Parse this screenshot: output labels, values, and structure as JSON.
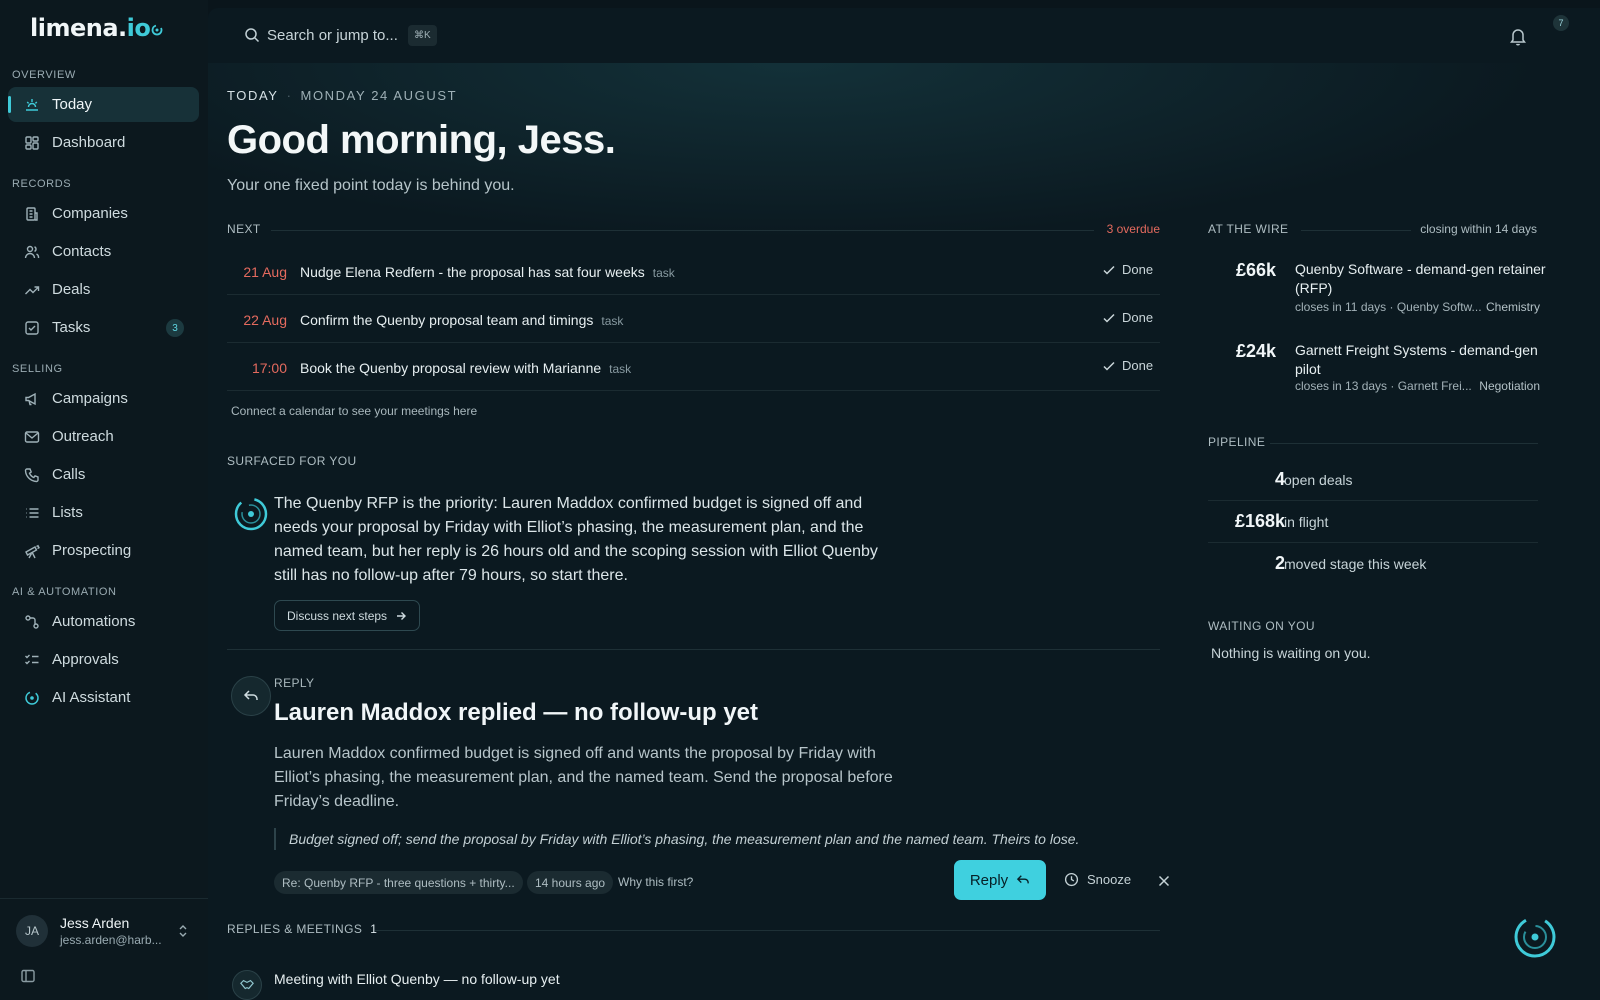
{
  "brand": {
    "logo_main": "limena.",
    "logo_accent": "io",
    "accent_color": "#3fcad8"
  },
  "sidebar": {
    "sections": {
      "overview": "OVERVIEW",
      "records": "RECORDS",
      "selling": "SELLING",
      "ai": "AI & AUTOMATION"
    },
    "items": {
      "today": "Today",
      "dashboard": "Dashboard",
      "companies": "Companies",
      "contacts": "Contacts",
      "deals": "Deals",
      "tasks": "Tasks",
      "tasks_badge": "3",
      "campaigns": "Campaigns",
      "outreach": "Outreach",
      "calls": "Calls",
      "lists": "Lists",
      "prospecting": "Prospecting",
      "automations": "Automations",
      "approvals": "Approvals",
      "assistant": "AI Assistant"
    },
    "user": {
      "initials": "JA",
      "name": "Jess Arden",
      "email": "jess.arden@harb..."
    }
  },
  "topbar": {
    "search_placeholder": "Search or jump to...",
    "shortcut": "⌘K",
    "notifications_count": "7"
  },
  "header": {
    "label": "TODAY",
    "date": "MONDAY 24 AUGUST",
    "greeting": "Good morning, Jess.",
    "subtitle": "Your one fixed point today is behind you."
  },
  "next": {
    "title": "NEXT",
    "overdue": "3 overdue",
    "done_label": "Done",
    "tasks": [
      {
        "date": "21 Aug",
        "title": "Nudge Elena Redfern - the proposal has sat four weeks",
        "tag": "task"
      },
      {
        "date": "22 Aug",
        "title": "Confirm the Quenby proposal team and timings",
        "tag": "task"
      },
      {
        "date": "17:00",
        "title": "Book the Quenby proposal review with Marianne",
        "tag": "task"
      }
    ],
    "calendar_hint": "Connect a calendar to see your meetings here"
  },
  "surfaced": {
    "title": "SURFACED FOR YOU",
    "text": "The Quenby RFP is the priority: Lauren Maddox confirmed budget is signed off and needs your proposal by Friday with Elliot’s phasing, the measurement plan, and the named team, but her reply is 26 hours old and the scoping session with Elliot Quenby still has no follow-up after 79 hours, so start there.",
    "button": "Discuss next steps"
  },
  "reply_card": {
    "label": "REPLY",
    "title": "Lauren Maddox replied — no follow-up yet",
    "body": "Lauren Maddox confirmed budget is signed off and wants the proposal by Friday with Elliot’s phasing, the measurement plan, and the named team. Send the proposal before Friday’s deadline.",
    "quote": "Budget signed off; send the proposal by Friday with Elliot’s phasing, the measurement plan and the named team. Theirs to lose.",
    "thread": "Re: Quenby RFP - three questions + thirty...",
    "age": "14 hours ago",
    "why": "Why this first?",
    "reply_button": "Reply",
    "snooze_button": "Snooze"
  },
  "replies_meetings": {
    "title": "REPLIES & MEETINGS",
    "count": "1",
    "first_item": "Meeting with Elliot Quenby — no follow-up yet"
  },
  "at_the_wire": {
    "title": "AT THE WIRE",
    "right": "closing within 14 days",
    "deals": [
      {
        "amount": "£66k",
        "title": "Quenby Software - demand-gen retainer (RFP)",
        "meta": "closes in 11 days · Quenby Softw...",
        "stage": "Chemistry"
      },
      {
        "amount": "£24k",
        "title": "Garnett Freight Systems - demand-gen pilot",
        "meta": "closes in 13 days · Garnett Frei...",
        "stage": "Negotiation"
      }
    ]
  },
  "pipeline": {
    "title": "PIPELINE",
    "rows": [
      {
        "value": "4",
        "label": "open deals"
      },
      {
        "value": "£168k",
        "label": "in flight"
      },
      {
        "value": "2",
        "label": "moved stage this week"
      }
    ]
  },
  "waiting": {
    "title": "WAITING ON YOU",
    "text": "Nothing is waiting on you."
  }
}
